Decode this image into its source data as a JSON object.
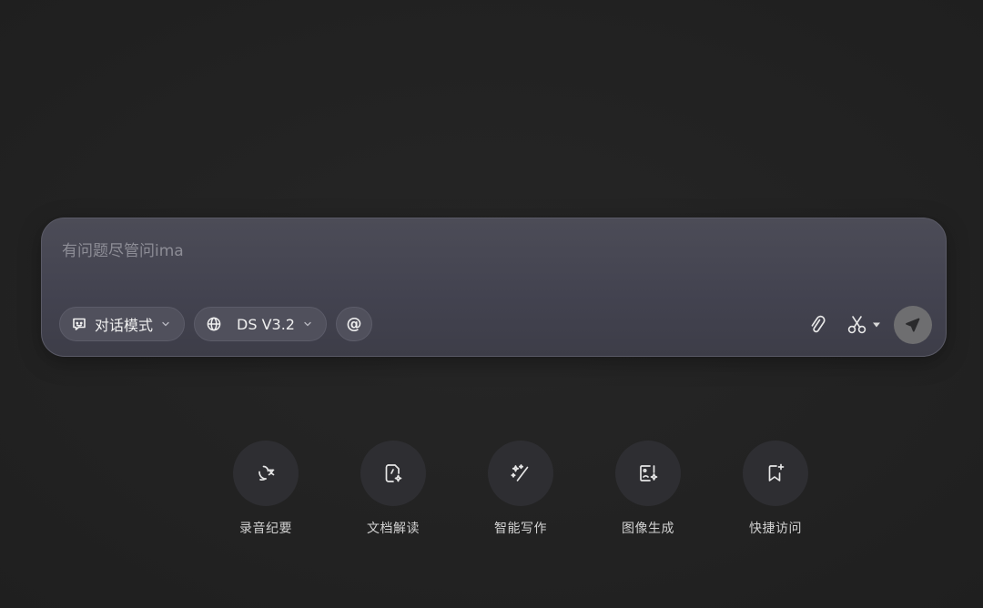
{
  "composer": {
    "placeholder": "有问题尽管问ima",
    "mode_label": "对话模式",
    "model_label": "DS V3.2",
    "mention_label": "@"
  },
  "quick_actions": [
    {
      "label": "录音纪要",
      "icon": "voice-record-icon"
    },
    {
      "label": "文档解读",
      "icon": "document-sparkle-icon"
    },
    {
      "label": "智能写作",
      "icon": "magic-wand-icon"
    },
    {
      "label": "图像生成",
      "icon": "image-generate-icon"
    },
    {
      "label": "快捷访问",
      "icon": "bookmark-add-icon"
    }
  ],
  "colors": {
    "background": "#232323",
    "composer": "#474753",
    "send_button": "#6e6e70"
  }
}
